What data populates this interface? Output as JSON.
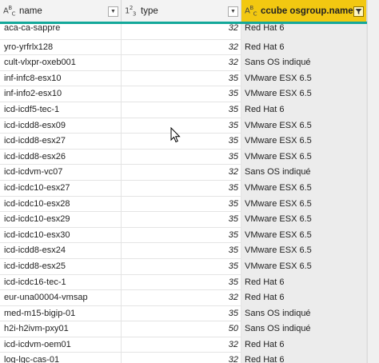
{
  "columns": [
    {
      "type_icon": "ABC",
      "label": "name"
    },
    {
      "type_icon": "123",
      "label": "type"
    },
    {
      "type_icon": "ABC",
      "label": "ccube osgroup.name"
    }
  ],
  "rows": [
    {
      "name": "aca-ca-sappre",
      "type": "32",
      "os": "Red Hat 6"
    },
    {
      "name": "yro-yrfrlx128",
      "type": "32",
      "os": "Red Hat 6"
    },
    {
      "name": "cult-vlxpr-oxeb001",
      "type": "32",
      "os": "Sans OS indiqué"
    },
    {
      "name": "inf-infc8-esx10",
      "type": "35",
      "os": "VMware ESX 6.5"
    },
    {
      "name": "inf-info2-esx10",
      "type": "35",
      "os": "VMware ESX 6.5"
    },
    {
      "name": "icd-icdf5-tec-1",
      "type": "35",
      "os": "Red Hat 6"
    },
    {
      "name": "icd-icdd8-esx09",
      "type": "35",
      "os": "VMware ESX 6.5"
    },
    {
      "name": "icd-icdd8-esx27",
      "type": "35",
      "os": "VMware ESX 6.5"
    },
    {
      "name": "icd-icdd8-esx26",
      "type": "35",
      "os": "VMware ESX 6.5"
    },
    {
      "name": "icd-icdvm-vc07",
      "type": "32",
      "os": "Sans OS indiqué"
    },
    {
      "name": "icd-icdc10-esx27",
      "type": "35",
      "os": "VMware ESX 6.5"
    },
    {
      "name": "icd-icdc10-esx28",
      "type": "35",
      "os": "VMware ESX 6.5"
    },
    {
      "name": "icd-icdc10-esx29",
      "type": "35",
      "os": "VMware ESX 6.5"
    },
    {
      "name": "icd-icdc10-esx30",
      "type": "35",
      "os": "VMware ESX 6.5"
    },
    {
      "name": "icd-icdd8-esx24",
      "type": "35",
      "os": "VMware ESX 6.5"
    },
    {
      "name": "icd-icdd8-esx25",
      "type": "35",
      "os": "VMware ESX 6.5"
    },
    {
      "name": "icd-icdc16-tec-1",
      "type": "35",
      "os": "Red Hat 6"
    },
    {
      "name": "eur-una00004-vmsap",
      "type": "32",
      "os": "Red Hat 6"
    },
    {
      "name": "med-m15-bigip-01",
      "type": "35",
      "os": "Sans OS indiqué"
    },
    {
      "name": "h2i-h2ivm-pxy01",
      "type": "50",
      "os": "Sans OS indiqué"
    },
    {
      "name": "icd-icdvm-oem01",
      "type": "32",
      "os": "Red Hat 6"
    },
    {
      "name": "log-lgc-cas-01",
      "type": "32",
      "os": "Red Hat 6"
    }
  ],
  "colors": {
    "filtered_header": "#f2c811",
    "accent_line": "#14a89a"
  },
  "icons": [
    "dropdown-icon",
    "filter-icon",
    "mouse-pointer-icon"
  ]
}
